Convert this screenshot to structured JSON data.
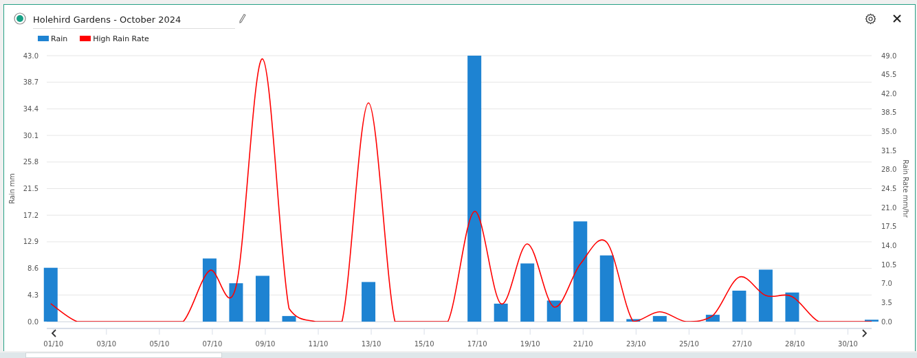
{
  "window": {
    "title": "Holehird Gardens - October 2024",
    "selected": true
  },
  "chart": {
    "chart_data": {
      "type": "bar",
      "categories": [
        "01/10",
        null,
        "03/10",
        null,
        "05/10",
        null,
        "07/10",
        null,
        "09/10",
        null,
        "11/10",
        null,
        "13/10",
        null,
        "15/10",
        null,
        "17/10",
        null,
        "19/10",
        null,
        "21/10",
        null,
        "23/10",
        null,
        "25/10",
        null,
        "27/10",
        null,
        "28/10",
        null,
        "30/10",
        null
      ],
      "grid": true,
      "ylabel": "Rain mm",
      "ylim": [
        0,
        43
      ],
      "yticks": [
        {
          "value": 0,
          "label": "0.0"
        },
        {
          "value": 4.3,
          "label": "4.3"
        },
        {
          "value": 8.6,
          "label": "8.6"
        },
        {
          "value": 12.9,
          "label": "12.9"
        },
        {
          "value": 17.2,
          "label": "17.2"
        },
        {
          "value": 21.5,
          "label": "21.5"
        },
        {
          "value": 25.8,
          "label": "25.8"
        },
        {
          "value": 30.1,
          "label": "30.1"
        },
        {
          "value": 34.4,
          "label": "34.4"
        },
        {
          "value": 38.7,
          "label": "38.7"
        },
        {
          "value": 43,
          "label": "43.0"
        }
      ],
      "y2label": "Rain Rate mm/hr",
      "y2lim": [
        0,
        49
      ],
      "y2ticks": [
        {
          "value": 0,
          "label": "0.0"
        },
        {
          "value": 3.5,
          "label": "3.5"
        },
        {
          "value": 7,
          "label": "7.0"
        },
        {
          "value": 10.5,
          "label": "10.5"
        },
        {
          "value": 14,
          "label": "14.0"
        },
        {
          "value": 17.5,
          "label": "17.5"
        },
        {
          "value": 21,
          "label": "21.0"
        },
        {
          "value": 24.5,
          "label": "24.5"
        },
        {
          "value": 28,
          "label": "28.0"
        },
        {
          "value": 31.5,
          "label": "31.5"
        },
        {
          "value": 35,
          "label": "35.0"
        },
        {
          "value": 38.5,
          "label": "38.5"
        },
        {
          "value": 42,
          "label": "42.0"
        },
        {
          "value": 45.5,
          "label": "45.5"
        },
        {
          "value": 49,
          "label": "49.0"
        }
      ],
      "series": [
        {
          "name": "Rain",
          "color": "#1e83d2",
          "values": [
            8.7,
            null,
            null,
            null,
            null,
            null,
            10.2,
            6.2,
            7.4,
            0.9,
            null,
            null,
            6.4,
            null,
            null,
            null,
            43.0,
            2.9,
            9.4,
            3.4,
            16.2,
            10.7,
            0.4,
            0.9,
            null,
            1.1,
            5.0,
            8.4,
            4.7,
            null,
            null,
            0.3
          ]
        },
        {
          "name": "High Rain Rate",
          "type": "line",
          "axis": "y2",
          "color": "#ff0000",
          "values": [
            3.3,
            0,
            0,
            0,
            0,
            0,
            9.4,
            6.5,
            48.4,
            2.4,
            0,
            0,
            40.3,
            0,
            0,
            0,
            20.3,
            3.3,
            14.3,
            2.7,
            10.6,
            14.6,
            0,
            1.8,
            0,
            1.1,
            8.2,
            4.8,
            4.6,
            0,
            0,
            0
          ]
        }
      ]
    }
  }
}
